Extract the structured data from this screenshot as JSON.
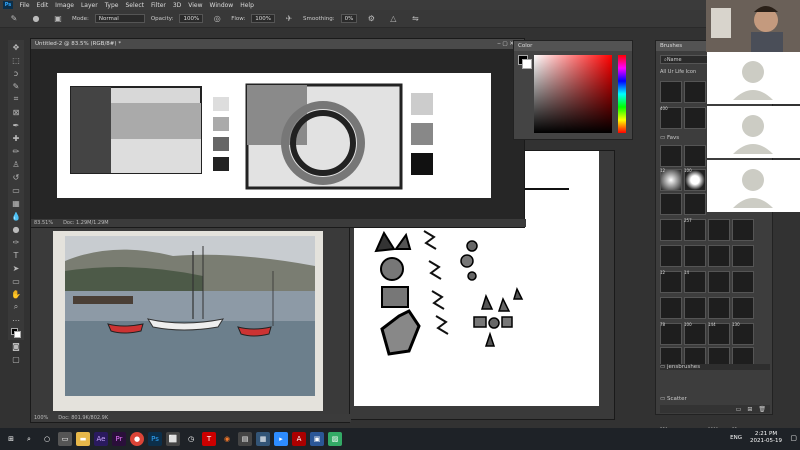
{
  "menubar": {
    "app_icon": "Ps",
    "items": [
      "File",
      "Edit",
      "Image",
      "Layer",
      "Type",
      "Select",
      "Filter",
      "3D",
      "View",
      "Window",
      "Help"
    ]
  },
  "options": {
    "mode_label": "Mode:",
    "mode_value": "Normal",
    "opacity_label": "Opacity:",
    "opacity_value": "100%",
    "flow_label": "Flow:",
    "flow_value": "100%",
    "smoothing_label": "Smoothing:",
    "smoothing_value": "0%"
  },
  "doc1": {
    "tab_title": "Untitled-2 @ 83.5% (RGB/8#) *",
    "status_zoom": "83.51%",
    "status_doc": "Doc: 1.29M/1.29M"
  },
  "doc2": {
    "status_zoom": "100%",
    "status_doc": "Doc: 801.9K/802.9K"
  },
  "color_panel": {
    "title": "Color"
  },
  "brushes_panel": {
    "title": "Brushes",
    "search_label": "Name",
    "group_favs": "Favs",
    "group_jens": "jensbrushes",
    "group_scatter": "Scatter",
    "top_group": "All Ur Life Icon",
    "numbers": [
      "400",
      "12",
      "100",
      "257",
      "12",
      "14",
      "78",
      "100",
      "144",
      "130",
      "250",
      "1800",
      "35"
    ]
  },
  "taskbar": {
    "lang": "ENG",
    "time": "2:21 PM",
    "date": "2021-05-19"
  },
  "colors": {
    "ps_blue": "#31a8ff",
    "canvas_white": "#ffffff",
    "panel_dark": "#3d3d3d"
  }
}
